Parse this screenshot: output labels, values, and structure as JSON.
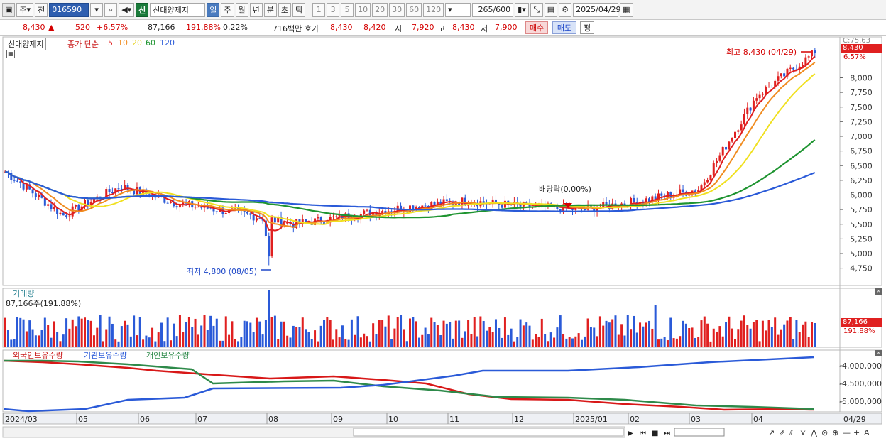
{
  "toolbar": {
    "market": "주",
    "prev": "전",
    "code": "016590",
    "shin": "신",
    "name": "신대양제지",
    "periods": [
      "일",
      "주",
      "월",
      "년",
      "분",
      "초",
      "틱"
    ],
    "active_period": "일",
    "minute_options": [
      "1",
      "3",
      "5",
      "10",
      "20",
      "30",
      "60",
      "120"
    ],
    "count": "265",
    "count_max": "/600",
    "date": "2025/04/29"
  },
  "quote": {
    "price": "8,430",
    "change_arrow": "▲",
    "change": "520",
    "change_pct": "+6.57%",
    "volume": "87,166",
    "volume_ratio": "191.88%",
    "turnover": "0.22%",
    "amount": "716백만",
    "bid_label": "호가",
    "ask": "8,430",
    "bid": "8,420",
    "open_label": "시",
    "open": "7,920",
    "high_label": "고",
    "high": "8,430",
    "low_label": "저",
    "low": "7,900",
    "buy_btn": "매수",
    "sell_btn": "매도",
    "ping_btn": "평"
  },
  "legend": {
    "stock": "신대양제지",
    "ma_label": "종가 단순",
    "ma_periods": [
      "5",
      "10",
      "20",
      "60",
      "120"
    ],
    "ma_colors": [
      "#e02020",
      "#f08c20",
      "#f0e020",
      "#1e9430",
      "#2a5ad8"
    ]
  },
  "annotations": {
    "high_marker": "최고 8,430 (04/29)",
    "low_marker": "최저 4,800 (08/05)",
    "dividend": "배당락(0.00%)"
  },
  "price_scale": {
    "top_label": "C:75.63",
    "current": "8,430",
    "current_pct": "6.57%",
    "ticks": [
      "8,000",
      "7,750",
      "7,500",
      "7,250",
      "7,000",
      "6,750",
      "6,500",
      "6,250",
      "6,000",
      "5,750",
      "5,500",
      "5,250",
      "5,000",
      "4,750"
    ]
  },
  "volume_panel": {
    "title": "거래량",
    "value": "87,166주(191.88%)",
    "axis_value": "87,166",
    "axis_pct": "191.88%"
  },
  "holdings_panel": {
    "foreign": "외국인보유수량",
    "institution": "기관보유수량",
    "individual": "개인보유수량",
    "ticks": [
      "-4,000,000",
      "-4,500,000",
      "-5,000,000"
    ]
  },
  "x_axis": {
    "labels": [
      "2024/03",
      "05",
      "06",
      "07",
      "08",
      "09",
      "10",
      "11",
      "12",
      "2025/01",
      "02",
      "03",
      "04"
    ],
    "current_date": "04/29"
  },
  "chart_data": {
    "type": "candlestick",
    "ylim": [
      4600,
      8600
    ],
    "x": [
      "2024/03",
      "05",
      "06",
      "07",
      "08",
      "09",
      "10",
      "11",
      "12",
      "2025/01",
      "02",
      "03",
      "04"
    ],
    "close_series": [
      {
        "date": "2024/03",
        "value": 6400
      },
      {
        "date": "04",
        "value": 5650
      },
      {
        "date": "05",
        "value": 6150
      },
      {
        "date": "06",
        "value": 5850
      },
      {
        "date": "07",
        "value": 5700
      },
      {
        "date": "08",
        "value": 5500
      },
      {
        "date": "09",
        "value": 5650
      },
      {
        "date": "10",
        "value": 5800
      },
      {
        "date": "11",
        "value": 5900
      },
      {
        "date": "12",
        "value": 5800
      },
      {
        "date": "2025/01",
        "value": 5750
      },
      {
        "date": "02",
        "value": 5900
      },
      {
        "date": "03",
        "value": 6100
      },
      {
        "date": "04",
        "value": 7700
      },
      {
        "date": "04/29",
        "value": 8430
      }
    ],
    "high": {
      "date": "04/29",
      "value": 8430
    },
    "low": {
      "date": "08/05",
      "value": 4800
    }
  },
  "colors": {
    "up": "#e02020",
    "down": "#2a5ad8",
    "foreign_line": "#d81818",
    "institution_line": "#2a5ad8",
    "individual_line": "#2e8a4a"
  }
}
